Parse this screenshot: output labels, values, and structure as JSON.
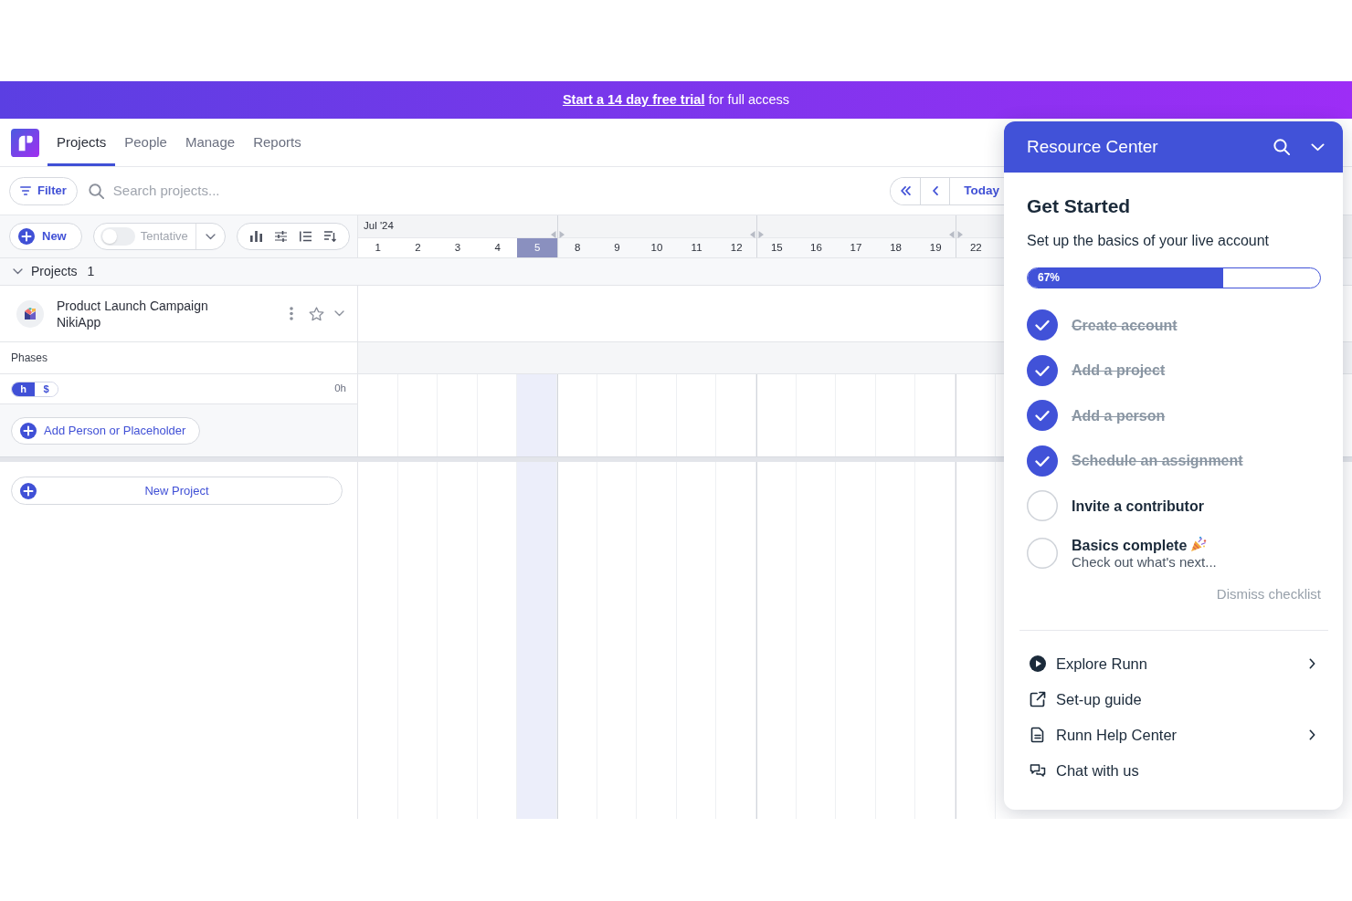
{
  "banner": {
    "link": "Start a 14 day free trial",
    "text": "for full access"
  },
  "nav": {
    "tabs": [
      {
        "label": "Projects",
        "selected": true
      },
      {
        "label": "People",
        "selected": false
      },
      {
        "label": "Manage",
        "selected": false
      },
      {
        "label": "Reports",
        "selected": false
      }
    ]
  },
  "toolbar": {
    "filter": "Filter",
    "search": {
      "placeholder": "Search projects..."
    },
    "today": "Today"
  },
  "controls": {
    "new": "New",
    "tentative": {
      "label": "Tentative",
      "on": false
    }
  },
  "timeline": {
    "month": "Jul '24",
    "weeks": [
      {
        "days": [
          {
            "label": "1",
            "selected": false
          },
          {
            "label": "2",
            "selected": false
          },
          {
            "label": "3",
            "selected": false
          },
          {
            "label": "4",
            "selected": false
          },
          {
            "label": "5",
            "selected": true
          }
        ]
      },
      {
        "days": [
          {
            "label": "8",
            "selected": false
          },
          {
            "label": "9",
            "selected": false
          },
          {
            "label": "10",
            "selected": false
          },
          {
            "label": "11",
            "selected": false
          },
          {
            "label": "12",
            "selected": false
          }
        ]
      },
      {
        "days": [
          {
            "label": "15",
            "selected": false
          },
          {
            "label": "16",
            "selected": false
          },
          {
            "label": "17",
            "selected": false
          },
          {
            "label": "18",
            "selected": false
          },
          {
            "label": "19",
            "selected": false
          }
        ]
      },
      {
        "days": [
          {
            "label": "22",
            "selected": false
          }
        ]
      }
    ]
  },
  "projects_group": {
    "label": "Projects",
    "count": "1",
    "expanded": true
  },
  "projects": [
    {
      "name": "Product Launch Campaign",
      "client": "NikiApp",
      "starred": false,
      "phases": "Phases",
      "units": [
        {
          "label": "h",
          "selected": true
        },
        {
          "label": "$",
          "selected": false
        }
      ],
      "total": "0h",
      "add_person": "Add Person or Placeholder"
    }
  ],
  "new_project": "New Project",
  "resource_center": {
    "title": "Resource Center",
    "heading": "Get Started",
    "subtitle": "Set up the basics of your live account",
    "progress": {
      "level": 0.67,
      "reading": "67%"
    },
    "checklist": [
      {
        "label": "Create account",
        "checked": true
      },
      {
        "label": "Add a project",
        "checked": true
      },
      {
        "label": "Add a person",
        "checked": true
      },
      {
        "label": "Schedule an assignment",
        "checked": true
      },
      {
        "label": "Invite a contributor",
        "checked": false
      },
      {
        "label": "Basics complete",
        "note": "Check out what's next...",
        "checked": false
      }
    ],
    "dismiss": "Dismiss checklist",
    "links": [
      {
        "kind": "tour",
        "label": "Explore Runn",
        "submenu": true
      },
      {
        "kind": "external",
        "label": "Set-up guide",
        "submenu": false
      },
      {
        "kind": "article",
        "label": "Runn Help Center",
        "submenu": true
      },
      {
        "kind": "chat",
        "label": "Chat with us",
        "submenu": false
      }
    ]
  }
}
